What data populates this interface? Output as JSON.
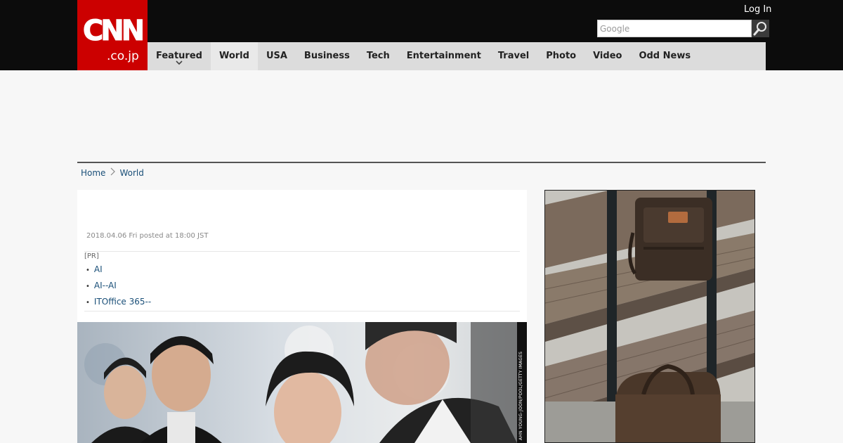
{
  "header": {
    "logo_main": "CNN",
    "logo_sub": ".co.jp",
    "login_label": "Log In",
    "search_placeholder": "Google"
  },
  "nav": {
    "items": [
      {
        "label": "Featured"
      },
      {
        "label": "World"
      },
      {
        "label": "USA"
      },
      {
        "label": "Business"
      },
      {
        "label": "Tech"
      },
      {
        "label": "Entertainment"
      },
      {
        "label": "Travel"
      },
      {
        "label": "Photo"
      },
      {
        "label": "Video"
      },
      {
        "label": "Odd News"
      }
    ],
    "active": "World"
  },
  "breadcrumb": {
    "home": "Home",
    "section": "World"
  },
  "article": {
    "posted": "2018.04.06 Fri posted at 18:00 JST",
    "pr_label": "[PR]",
    "pr_links": [
      "AI",
      "AI--AI",
      "ITOffice 365--"
    ],
    "photo_credit": "AHN YOUNG-JOON/POOL/GETTY IMAGES"
  },
  "colors": {
    "brand_red": "#cc0000",
    "header_bg": "#0c0c0c",
    "nav_bg": "#dcdcdc",
    "link": "#1a4f78"
  }
}
